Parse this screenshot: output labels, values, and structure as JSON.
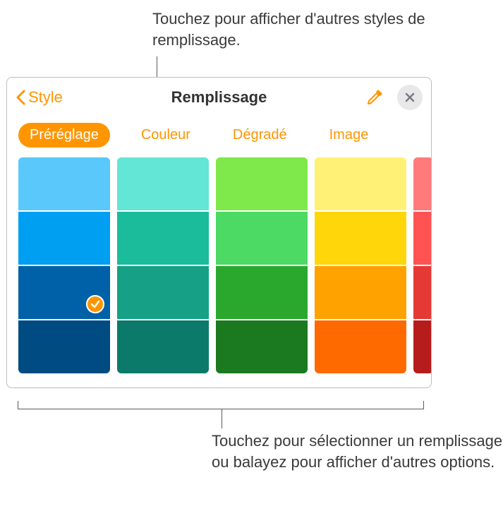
{
  "callouts": {
    "top": "Touchez pour afficher d'autres styles de remplissage.",
    "bottom": "Touchez pour sélectionner un remplissage ou balayez pour afficher d'autres options."
  },
  "header": {
    "back_label": "Style",
    "title": "Remplissage"
  },
  "tabs": [
    {
      "label": "Préréglage",
      "active": true
    },
    {
      "label": "Couleur",
      "active": false
    },
    {
      "label": "Dégradé",
      "active": false
    },
    {
      "label": "Image",
      "active": false
    }
  ],
  "swatches": {
    "columns": [
      {
        "colors": [
          "#5ac8fa",
          "#009ff2",
          "#0061a8",
          "#004b82"
        ],
        "selectedIndex": 2
      },
      {
        "colors": [
          "#64e6d6",
          "#1abc9c",
          "#16a085",
          "#0c7a6a"
        ],
        "selectedIndex": -1
      },
      {
        "colors": [
          "#7fe84a",
          "#4cd964",
          "#2aa82e",
          "#1b7a1f"
        ],
        "selectedIndex": -1
      },
      {
        "colors": [
          "#fff176",
          "#ffd60a",
          "#ffa200",
          "#ff6a00"
        ],
        "selectedIndex": -1
      },
      {
        "colors": [
          "#ff7a7a",
          "#ff5252",
          "#e53935",
          "#b71c1c"
        ],
        "selectedIndex": -1,
        "partial": true
      }
    ]
  }
}
